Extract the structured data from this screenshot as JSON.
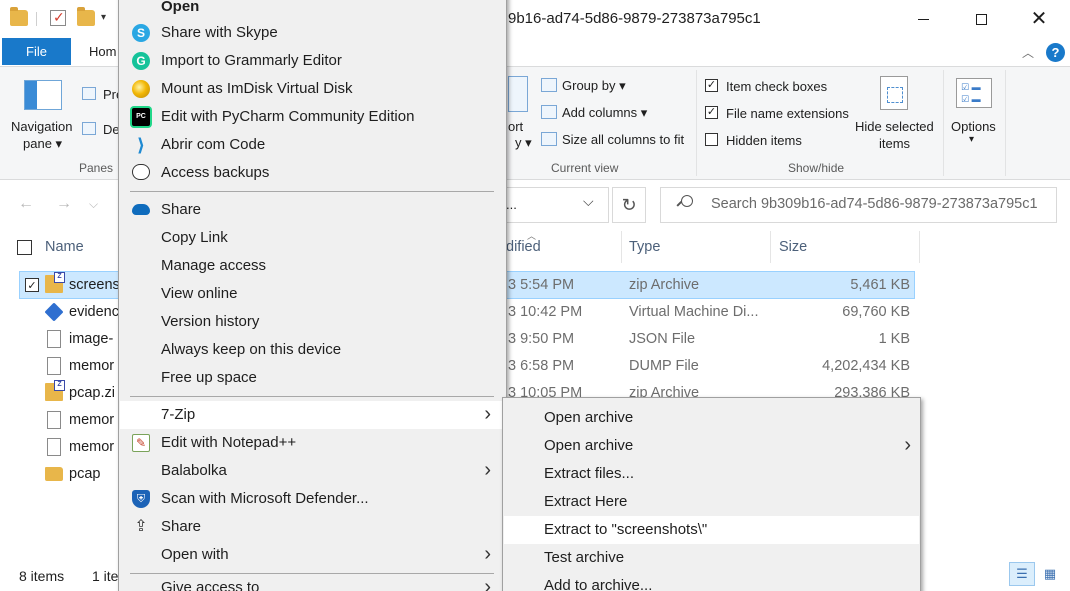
{
  "window": {
    "title": "9b16-ad74-5d86-9879-273873a795c1",
    "minimize": "—",
    "close": "✕"
  },
  "ribbon": {
    "tab_file": "File",
    "tab_home": "Hom",
    "help": "?",
    "collapse": "︿",
    "nav_pane_label_1": "Navigation",
    "nav_pane_label_2": "pane ▾",
    "preview_label": "Pre",
    "details_label": "De",
    "panes_group": "Panes",
    "sort_label_1": "ort",
    "sort_label_2": "y ▾",
    "group_by": "Group by ▾",
    "add_columns": "Add columns ▾",
    "size_all_columns": "Size all columns to fit",
    "current_view_group": "Current view",
    "item_check_boxes": "Item check boxes",
    "file_name_extensions": "File name extensions",
    "hidden_items": "Hidden items",
    "hide_selected_1": "Hide selected",
    "hide_selected_2": "items",
    "show_hide_group": "Show/hide",
    "options_label": "Options",
    "options_caret": "▾",
    "checks": {
      "item_check_boxes": "✓",
      "file_name_extensions": "✓",
      "hidden_items": ""
    }
  },
  "address": {
    "path_tail": "...",
    "chevron": "⌵",
    "refresh": "↻",
    "search_placeholder": "Search 9b309b16-ad74-5d86-9879-273873a795c1"
  },
  "nav": {
    "back": "←",
    "forward": "→",
    "recent": "⌵"
  },
  "columns": {
    "name": "Name",
    "modified": "dified",
    "type": "Type",
    "size": "Size"
  },
  "files": [
    {
      "name": "screens",
      "modified": "3 5:54 PM",
      "type": "zip Archive",
      "size": "5,461 KB",
      "icon": "zip-icon"
    },
    {
      "name": "evidenc",
      "modified": "3 10:42 PM",
      "type": "Virtual Machine Di...",
      "size": "69,760 KB",
      "icon": "vm-disk-icon"
    },
    {
      "name": "image-",
      "modified": "3 9:50 PM",
      "type": "JSON File",
      "size": "1 KB",
      "icon": "document-icon"
    },
    {
      "name": "memor",
      "modified": "3 6:58 PM",
      "type": "DUMP File",
      "size": "4,202,434 KB",
      "icon": "document-icon"
    },
    {
      "name": "pcap.zi",
      "modified": "3 10:05 PM",
      "type": "zip Archive",
      "size": "293,386 KB",
      "icon": "zip-icon"
    },
    {
      "name": "memor",
      "icon": "document-icon"
    },
    {
      "name": "memor",
      "icon": "document-icon"
    },
    {
      "name": "pcap",
      "icon": "folder-icon"
    }
  ],
  "selected_check": "✓",
  "status": {
    "items": "8 items",
    "selected": "1 ite"
  },
  "context_menu": {
    "open": "Open",
    "items": [
      {
        "label": "Share with Skype",
        "icon": "skype-icon",
        "glyph": "S"
      },
      {
        "label": "Import to Grammarly Editor",
        "icon": "grammarly-icon",
        "glyph": "G"
      },
      {
        "label": "Mount as ImDisk Virtual Disk",
        "icon": "imdisk-icon",
        "glyph": ""
      },
      {
        "label": "Edit with PyCharm Community Edition",
        "icon": "pycharm-icon",
        "glyph": "PC"
      },
      {
        "label": "Abrir com Code",
        "icon": "vscode-icon",
        "glyph": "⟩"
      },
      {
        "label": "Access backups",
        "icon": "backup-icon",
        "glyph": ""
      },
      {
        "label": "Share",
        "icon": "onedrive-icon",
        "glyph": ""
      },
      {
        "label": "Copy Link"
      },
      {
        "label": "Manage access"
      },
      {
        "label": "View online"
      },
      {
        "label": "Version history"
      },
      {
        "label": "Always keep on this device"
      },
      {
        "label": "Free up space"
      },
      {
        "label": "7-Zip",
        "submenu": true
      },
      {
        "label": "Edit with Notepad++",
        "icon": "notepad-plus-plus-icon",
        "glyph": "✎"
      },
      {
        "label": "Balabolka",
        "submenu": true
      },
      {
        "label": "Scan with Microsoft Defender...",
        "icon": "defender-icon",
        "glyph": "⛨"
      },
      {
        "label": "Share",
        "icon": "share-icon",
        "glyph": "⇪"
      },
      {
        "label": "Open with",
        "submenu": true
      },
      {
        "label": "Give access to",
        "submenu": true
      }
    ],
    "arrow": "❯"
  },
  "sevenzip_submenu": [
    {
      "label": "Open archive"
    },
    {
      "label": "Open archive",
      "submenu": true
    },
    {
      "label": "Extract files..."
    },
    {
      "label": "Extract Here"
    },
    {
      "label": "Extract to \"screenshots\\\"",
      "highlighted": true
    },
    {
      "label": "Test archive"
    },
    {
      "label": "Add to archive..."
    }
  ],
  "view_buttons": {
    "details": "☰",
    "tiles": "▦"
  }
}
